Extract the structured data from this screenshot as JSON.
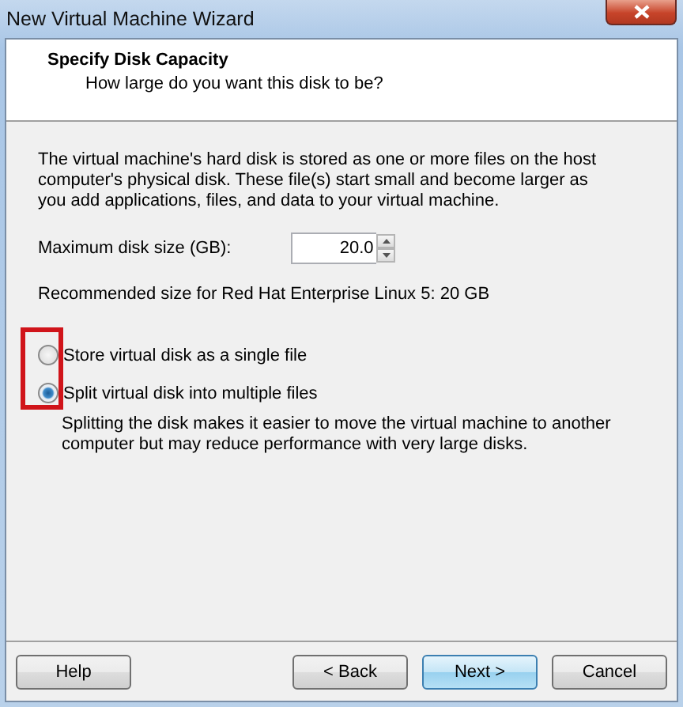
{
  "window": {
    "title": "New Virtual Machine Wizard"
  },
  "header": {
    "title": "Specify Disk Capacity",
    "subtitle": "How large do you want this disk to be?"
  },
  "description": "The virtual machine's hard disk is stored as one or more files on the host computer's physical disk. These file(s) start small and become larger as you add applications, files, and data to your virtual machine.",
  "disk_size": {
    "label": "Maximum disk size (GB):",
    "value": "20.0"
  },
  "recommendation": "Recommended size for Red Hat Enterprise Linux 5: 20 GB",
  "storage_options": {
    "highlighted": true,
    "items": [
      {
        "label": "Store virtual disk as a single file",
        "selected": false
      },
      {
        "label": "Split virtual disk into multiple files",
        "selected": true
      }
    ]
  },
  "split_note": "Splitting the disk makes it easier to move the virtual machine to another computer but may reduce performance with very large disks.",
  "buttons": [
    {
      "label": "Help",
      "kind": "left",
      "default": false
    },
    {
      "label": "< Back",
      "kind": "right",
      "default": false
    },
    {
      "label": "Next >",
      "kind": "right",
      "default": true
    },
    {
      "label": "Cancel",
      "kind": "right",
      "default": false
    }
  ]
}
